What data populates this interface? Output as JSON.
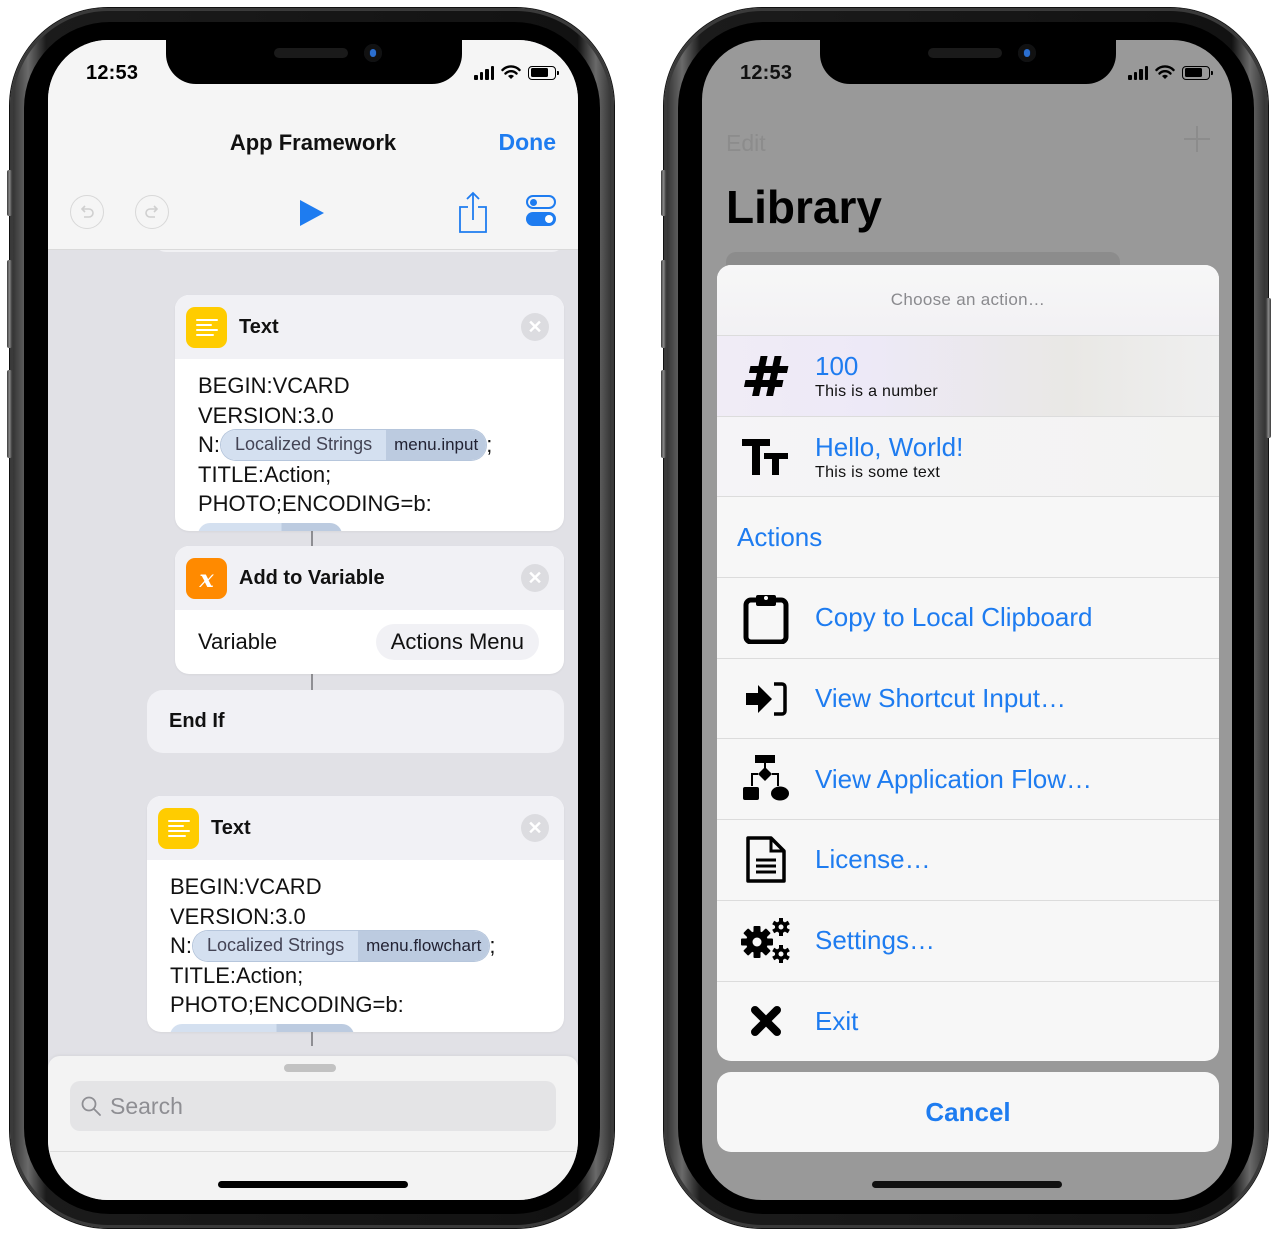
{
  "left_phone": {
    "status_bar": {
      "time": "12:53"
    },
    "nav": {
      "title": "App Framework",
      "done_label": "Done",
      "toolbar": {
        "undo_icon": "undo-icon",
        "redo_icon": "redo-icon",
        "play_icon": "play-icon",
        "share_icon": "share-icon",
        "settings_icon": "toggles-icon"
      }
    },
    "actions": [
      {
        "type": "text",
        "icon": "text-lines-icon",
        "title": "Text",
        "lines": [
          "BEGIN:VCARD",
          "VERSION:3.0"
        ],
        "n_prefix": "N:",
        "token": {
          "source": "Localized Strings",
          "key": "menu.input"
        },
        "n_suffix": ";",
        "after_lines": [
          "TITLE:Action;",
          "PHOTO;ENCODING=b:"
        ]
      },
      {
        "type": "add_to_variable",
        "icon": "variable-x-icon",
        "icon_glyph": "x",
        "title": "Add to Variable",
        "param_label": "Variable",
        "param_value": "Actions Menu"
      },
      {
        "type": "end_if",
        "title": "End If"
      },
      {
        "type": "text",
        "icon": "text-lines-icon",
        "title": "Text",
        "lines": [
          "BEGIN:VCARD",
          "VERSION:3.0"
        ],
        "n_prefix": "N:",
        "token": {
          "source": "Localized Strings",
          "key": "menu.flowchart"
        },
        "n_suffix": ";",
        "after_lines": [
          "TITLE:Action;",
          "PHOTO;ENCODING=b:"
        ]
      }
    ],
    "search": {
      "placeholder": "Search",
      "value": ""
    }
  },
  "right_phone": {
    "status_bar": {
      "time": "12:53"
    },
    "background": {
      "edit_label": "Edit",
      "add_icon": "plus-icon",
      "title": "Library"
    },
    "action_sheet": {
      "prompt": "Choose an action…",
      "items": [
        {
          "icon": "hashtag-icon",
          "label": "100",
          "subtitle": "This is a number"
        },
        {
          "icon": "text-size-icon",
          "label": "Hello, World!",
          "subtitle": "This is some text"
        }
      ],
      "section_label": "Actions",
      "actions": [
        {
          "icon": "clipboard-icon",
          "label": "Copy to Local Clipboard"
        },
        {
          "icon": "sign-in-icon",
          "label": "View Shortcut Input…"
        },
        {
          "icon": "flowchart-icon",
          "label": "View Application Flow…"
        },
        {
          "icon": "document-icon",
          "label": "License…"
        },
        {
          "icon": "gears-icon",
          "label": "Settings…"
        },
        {
          "icon": "close-x-icon",
          "label": "Exit"
        }
      ],
      "cancel_label": "Cancel"
    }
  },
  "colors": {
    "accent_blue": "#1e7cf0",
    "text_icon_yellow": "#ffcc00",
    "variable_icon_orange": "#ff8a00",
    "token_pill_blue": "#d4e0f0"
  }
}
